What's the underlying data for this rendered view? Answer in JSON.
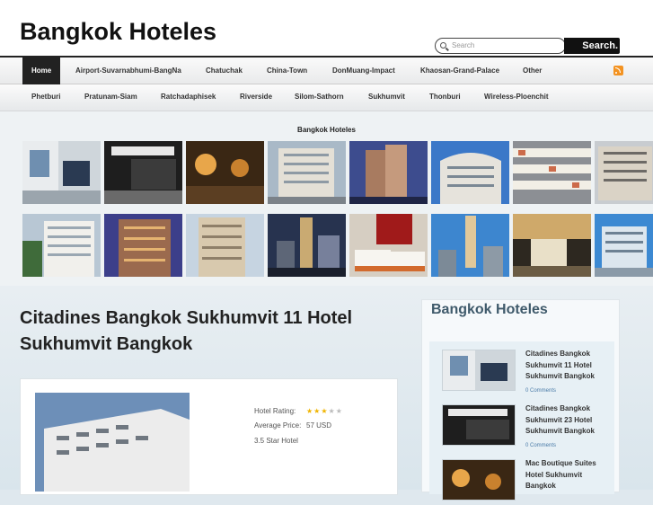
{
  "site": {
    "title": "Bangkok Hoteles"
  },
  "search": {
    "placeholder": "Search",
    "button_label": "Search."
  },
  "nav_primary": [
    {
      "label": "Home",
      "active": true
    },
    {
      "label": "Airport-Suvarnabhumi-BangNa"
    },
    {
      "label": "Chatuchak"
    },
    {
      "label": "China-Town"
    },
    {
      "label": "DonMuang-Impact"
    },
    {
      "label": "Khaosan-Grand-Palace"
    },
    {
      "label": "Other"
    }
  ],
  "nav_secondary": [
    {
      "label": "Phetburi"
    },
    {
      "label": "Pratunam-Siam"
    },
    {
      "label": "Ratchadaphisek"
    },
    {
      "label": "Riverside"
    },
    {
      "label": "Silom-Sathorn"
    },
    {
      "label": "Sukhumvit"
    },
    {
      "label": "Thonburi"
    },
    {
      "label": "Wireless-Ploenchit"
    }
  ],
  "gallery": {
    "title": "Bangkok Hoteles",
    "image_count": 16
  },
  "post": {
    "title": "Citadines Bangkok Sukhumvit 11 Hotel Sukhumvit Bangkok",
    "rating_label": "Hotel Rating:",
    "rating_stars": 3,
    "rating_max": 5,
    "price_label": "Average Price:",
    "price_value": "57 USD",
    "class_text": "3.5 Star Hotel"
  },
  "sidebar": {
    "title": "Bangkok Hoteles",
    "items": [
      {
        "title": "Citadines Bangkok Sukhumvit 11 Hotel Sukhumvit Bangkok",
        "comments": "0 Comments"
      },
      {
        "title": "Citadines Bangkok Sukhumvit 23 Hotel Sukhumvit Bangkok",
        "comments": "0 Comments"
      },
      {
        "title": "Mac Boutique Suites Hotel Sukhumvit Bangkok",
        "comments": ""
      }
    ]
  },
  "colors": {
    "accent": "#222222",
    "link": "#4a7ba8",
    "rss": "#f39322",
    "star_on": "#f0b400",
    "star_off": "#bbbbbb"
  }
}
